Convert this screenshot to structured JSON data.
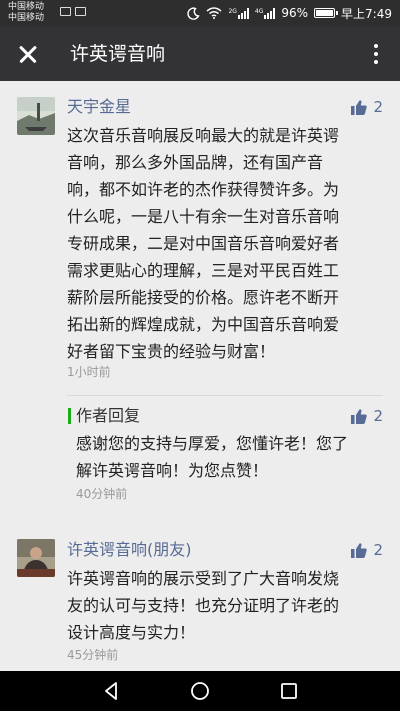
{
  "status_bar": {
    "carrier_1": "中国移动",
    "carrier_2": "中国移动",
    "battery": "96%",
    "time": "早上7:49",
    "signal_1": "2G",
    "signal_2": "4G",
    "battery_level": 0.96
  },
  "app_bar": {
    "title": "许英谔音响"
  },
  "comments": [
    {
      "author": "天宇金星",
      "likes": "2",
      "lines": [
        "这次音乐音响展反响最大的就是许英谔",
        "音响，那么多外国品牌，还有国产音",
        "响，都不如许老的杰作获得赞许多。为",
        "什么呢，一是八十有余一生对音乐音响",
        "专研成果，二是对中国音乐音响爱好者",
        "需求更贴心的理解，三是对平民百姓工",
        "薪阶层所能接受的价格。愿许老不断开",
        "拓出新的辉煌成就，为中国音乐音响爱",
        "好者留下宝贵的经验与财富！"
      ],
      "time": "1小时前",
      "reply": {
        "author": "作者回复",
        "likes": "2",
        "lines": [
          "感谢您的支持与厚爱，您懂许老！您了",
          "解许英谔音响！为您点赞！"
        ],
        "time": "40分钟前"
      }
    },
    {
      "author": "许英谔音响(朋友)",
      "likes": "2",
      "lines": [
        "许英谔音响的展示受到了广大音响发烧",
        "友的认可与支持！也充分证明了许老的",
        "设计高度与实力！"
      ],
      "time": "45分钟前"
    }
  ],
  "icons": {
    "back": "close-icon",
    "more": "more-vertical-icon",
    "like": "thumbs-up-icon",
    "nav_back": "triangle-back-icon",
    "nav_home": "circle-home-icon",
    "nav_recent": "square-recent-icon"
  },
  "colors": {
    "app_bar": "#333336",
    "name_link": "#576b95",
    "reply_bar": "#1aad19",
    "background": "#ededed"
  }
}
